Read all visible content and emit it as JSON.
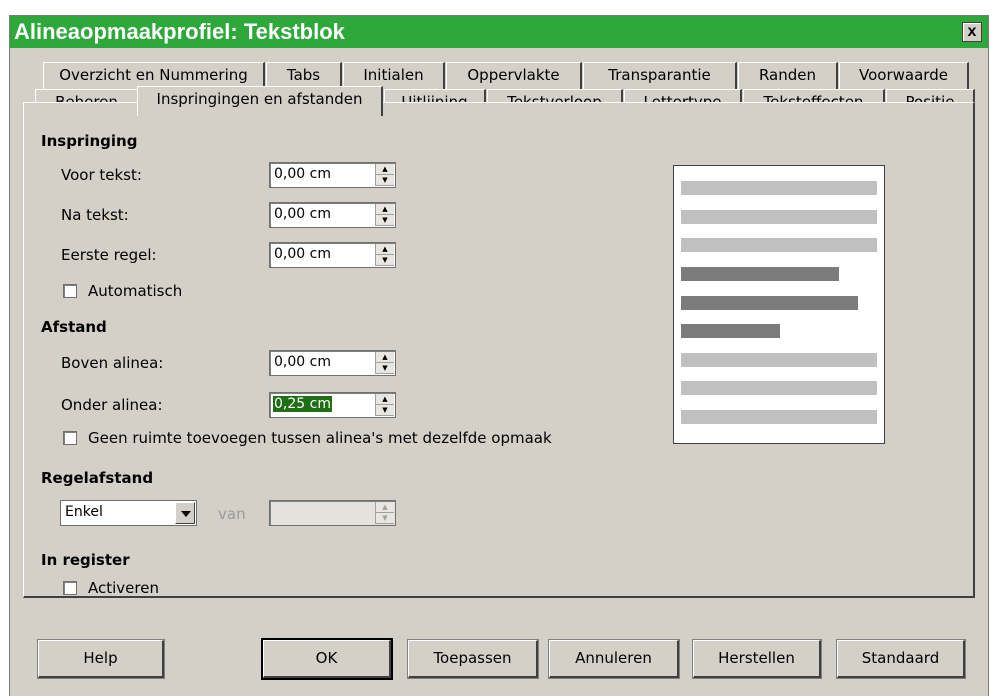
{
  "dialog": {
    "title": "Alineaopmaakprofiel: Tekstblok",
    "close_label": "x"
  },
  "tabs_row1": [
    {
      "label": "Overzicht en Nummering"
    },
    {
      "label": "Tabs"
    },
    {
      "label": "Initialen"
    },
    {
      "label": "Oppervlakte"
    },
    {
      "label": "Transparantie"
    },
    {
      "label": "Randen"
    },
    {
      "label": "Voorwaarde"
    }
  ],
  "tabs_row2": [
    {
      "label": "Beheren"
    },
    {
      "label": "Inspringingen en afstanden"
    },
    {
      "label": "Uitlijning"
    },
    {
      "label": "Tekstverloop"
    },
    {
      "label": "Lettertype"
    },
    {
      "label": "Teksteffecten"
    },
    {
      "label": "Positie"
    }
  ],
  "active_tab": "Inspringingen en afstanden",
  "indent": {
    "heading": "Inspringing",
    "before_label": "Voor tekst:",
    "before_value": "0,00 cm",
    "after_label": "Na tekst:",
    "after_value": "0,00 cm",
    "first_label": "Eerste regel:",
    "first_value": "0,00 cm",
    "auto_label": "Automatisch",
    "auto_checked": false
  },
  "spacing": {
    "heading": "Afstand",
    "above_label": "Boven alinea:",
    "above_value": "0,00 cm",
    "below_label": "Onder alinea:",
    "below_value": "0,25 cm",
    "no_space_label": "Geen ruimte toevoegen tussen alinea's met dezelfde opmaak",
    "no_space_checked": false
  },
  "line_spacing": {
    "heading": "Regelafstand",
    "selected": "Enkel",
    "of_label": "van",
    "of_value": ""
  },
  "register": {
    "heading": "In register",
    "activate_label": "Activeren",
    "activate_checked": false
  },
  "buttons": {
    "help": "Help",
    "ok": "OK",
    "apply": "Toepassen",
    "cancel": "Annuleren",
    "reset": "Herstellen",
    "standard": "Standaard"
  },
  "colors": {
    "titlebar": "#2ea83a",
    "selection": "#1e6f16",
    "preview_light": "#c0c0c0",
    "preview_dark": "#7b7b7b"
  }
}
